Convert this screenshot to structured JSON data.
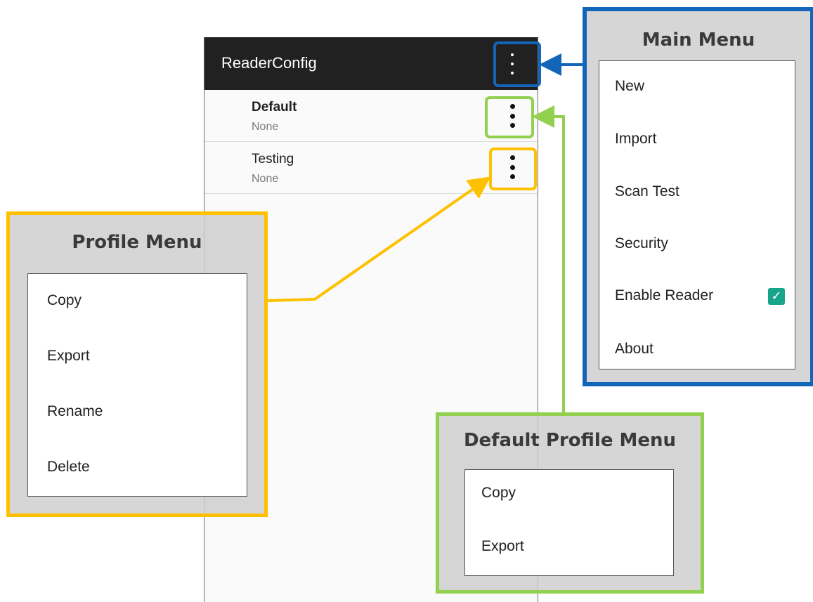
{
  "phone": {
    "app_title": "ReaderConfig",
    "profiles": [
      {
        "name": "Default",
        "subtitle": "None"
      },
      {
        "name": "Testing",
        "subtitle": "None"
      }
    ]
  },
  "callouts": {
    "main_menu": {
      "title": "Main Menu",
      "items": [
        "New",
        "Import",
        "Scan Test",
        "Security",
        "Enable Reader",
        "About"
      ],
      "enable_reader_checked": true
    },
    "profile_menu": {
      "title": "Profile Menu",
      "items": [
        "Copy",
        "Export",
        "Rename",
        "Delete"
      ]
    },
    "default_profile_menu": {
      "title": "Default Profile Menu",
      "items": [
        "Copy",
        "Export"
      ]
    }
  },
  "colors": {
    "main_menu": "#1265b8",
    "profile_menu": "#ffc000",
    "default_profile_menu": "#92d050",
    "checkbox": "#17a589",
    "appbar": "#212121"
  },
  "icons": {
    "overflow": "more-vertical-icon",
    "check": "checkmark-icon"
  }
}
